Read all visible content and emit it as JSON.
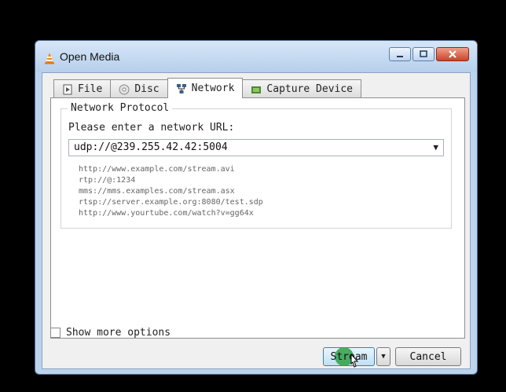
{
  "window": {
    "title": "Open Media",
    "icon": "vlc-cone-icon"
  },
  "tabs": [
    {
      "label": "File",
      "icon": "file-icon",
      "active": false
    },
    {
      "label": "Disc",
      "icon": "disc-icon",
      "active": false
    },
    {
      "label": "Network",
      "icon": "network-icon",
      "active": true
    },
    {
      "label": "Capture Device",
      "icon": "capture-device-icon",
      "active": false
    }
  ],
  "network": {
    "group_title": "Network Protocol",
    "url_label": "Please enter a network URL:",
    "url_value": "udp://@239.255.42.42:5004",
    "examples": [
      "http://www.example.com/stream.avi",
      "rtp://@:1234",
      "mms://mms.examples.com/stream.asx",
      "rtsp://server.example.org:8080/test.sdp",
      "http://www.yourtube.com/watch?v=gg64x"
    ]
  },
  "options": {
    "show_more_label": "Show more options",
    "checked": false
  },
  "buttons": {
    "stream_label": "Stream",
    "cancel_label": "Cancel"
  },
  "colors": {
    "accent": "#2ea046",
    "title_bar": "#bcd3ee",
    "close": "#c9432a"
  }
}
